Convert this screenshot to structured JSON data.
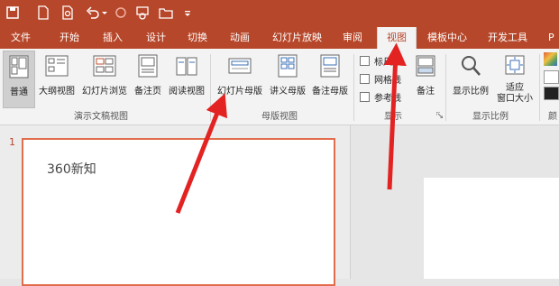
{
  "qat": {
    "icons": [
      "save-icon",
      "new-file-icon",
      "print-preview-icon",
      "undo-icon",
      "redo-icon",
      "presentation-icon",
      "open-folder-icon",
      "customize-dropdown-icon"
    ]
  },
  "tabs": [
    {
      "label": "文件"
    },
    {
      "label": "开始"
    },
    {
      "label": "插入"
    },
    {
      "label": "设计"
    },
    {
      "label": "切换"
    },
    {
      "label": "动画"
    },
    {
      "label": "幻灯片放映"
    },
    {
      "label": "审阅"
    },
    {
      "label": "视图"
    },
    {
      "label": "模板中心"
    },
    {
      "label": "开发工具"
    },
    {
      "label": "P"
    }
  ],
  "active_tab": "视图",
  "ribbon": {
    "presentation_views": {
      "group_label": "演示文稿视图",
      "buttons": [
        {
          "label": "普通"
        },
        {
          "label": "大纲视图"
        },
        {
          "label": "幻灯片浏览"
        },
        {
          "label": "备注页"
        },
        {
          "label": "阅读视图"
        }
      ]
    },
    "master_views": {
      "group_label": "母版视图",
      "buttons": [
        {
          "label": "幻灯片母版"
        },
        {
          "label": "讲义母版"
        },
        {
          "label": "备注母版"
        }
      ]
    },
    "show": {
      "group_label": "显示",
      "checkboxes": [
        {
          "label": "标尺",
          "checked": false
        },
        {
          "label": "网格线",
          "checked": false
        },
        {
          "label": "参考线",
          "checked": false
        }
      ],
      "notes_label": "备注"
    },
    "zoom": {
      "group_label": "显示比例",
      "zoom_label": "显示比例",
      "fit_label_1": "适应",
      "fit_label_2": "窗口大小"
    },
    "color_label": "颜"
  },
  "slides_pane": {
    "slide_number": "1",
    "thumbnail_text": "360新知"
  },
  "colors": {
    "brand": "#b7472a",
    "arrow": "#e32222",
    "thumb_border": "#e26d4d"
  }
}
